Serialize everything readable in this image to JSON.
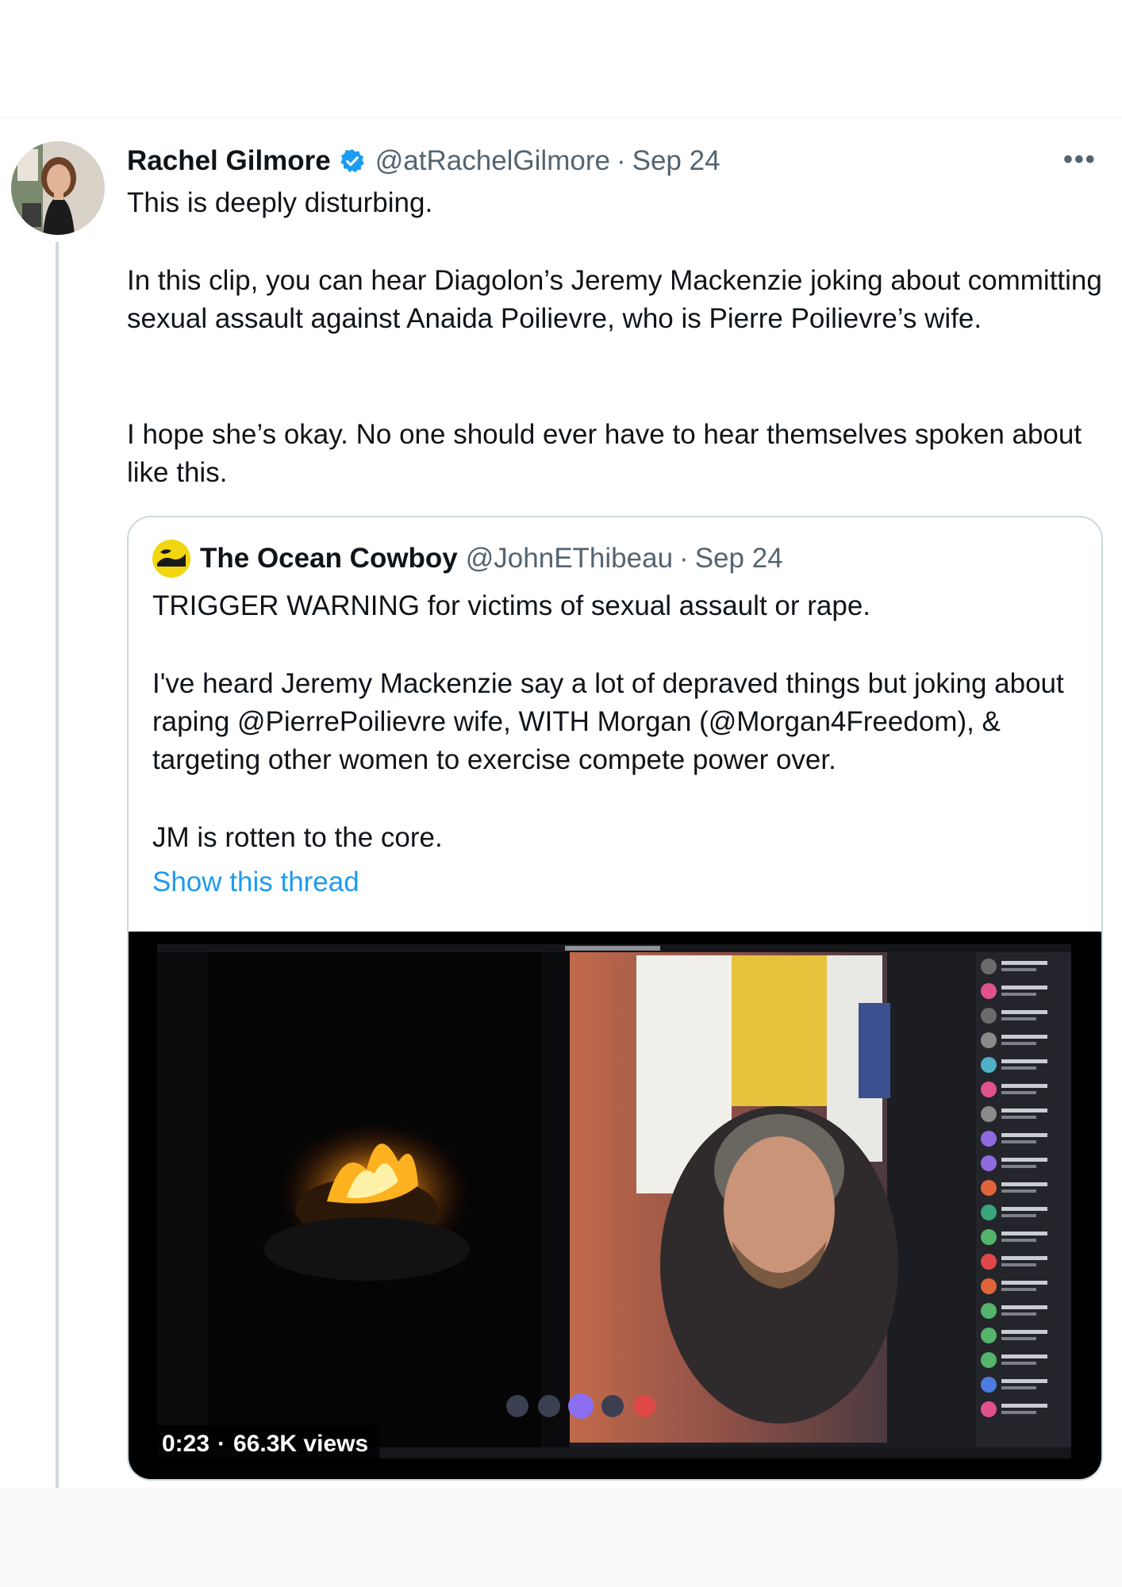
{
  "tweet": {
    "author_name": "Rachel Gilmore",
    "handle": "@atRachelGilmore",
    "separator": "·",
    "date": "Sep 24",
    "more_label": "•••",
    "paragraphs": [
      "This is deeply disturbing.",
      "In this clip, you can hear Diagolon’s Jeremy Mackenzie joking about committing sexual assault against Anaida Poilievre, who is Pierre Poilievre’s wife.",
      "I hope she’s okay. No one should ever have to hear themselves spoken about like this."
    ]
  },
  "quote": {
    "author_name": "The Ocean Cowboy",
    "handle": "@JohnEThibeau",
    "separator": "·",
    "date": "Sep 24",
    "paragraphs": [
      "TRIGGER WARNING for victims of sexual assault or rape.",
      "I've heard Jeremy Mackenzie say a lot of depraved things but joking about raping @PierrePoilievre wife, WITH Morgan (@Morgan4Freedom), & targeting other women to exercise compete power over.",
      "JM is rotten to the core."
    ],
    "show_thread": "Show this thread",
    "video": {
      "duration": "0:23",
      "separator": "·",
      "views": "66.3K views"
    }
  },
  "colors": {
    "accent": "#1d9bf0",
    "secondary_text": "#536471",
    "border": "#cfd9de"
  }
}
